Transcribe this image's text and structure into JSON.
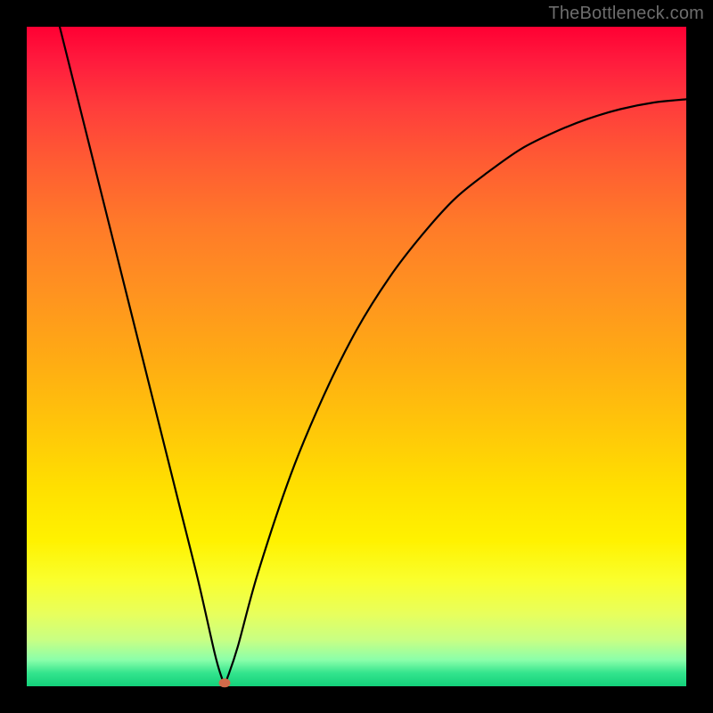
{
  "watermark": {
    "text": "TheBottleneck.com"
  },
  "chart_data": {
    "type": "line",
    "title": "",
    "xlabel": "",
    "ylabel": "",
    "xlim": [
      0,
      1
    ],
    "ylim": [
      0,
      1
    ],
    "series": [
      {
        "name": "curve",
        "points": [
          {
            "x": 0.05,
            "y": 1.0
          },
          {
            "x": 0.08,
            "y": 0.88
          },
          {
            "x": 0.11,
            "y": 0.76
          },
          {
            "x": 0.14,
            "y": 0.64
          },
          {
            "x": 0.17,
            "y": 0.52
          },
          {
            "x": 0.2,
            "y": 0.4
          },
          {
            "x": 0.23,
            "y": 0.28
          },
          {
            "x": 0.26,
            "y": 0.16
          },
          {
            "x": 0.285,
            "y": 0.05
          },
          {
            "x": 0.295,
            "y": 0.015
          },
          {
            "x": 0.3,
            "y": 0.005
          },
          {
            "x": 0.305,
            "y": 0.015
          },
          {
            "x": 0.32,
            "y": 0.06
          },
          {
            "x": 0.35,
            "y": 0.17
          },
          {
            "x": 0.4,
            "y": 0.32
          },
          {
            "x": 0.45,
            "y": 0.44
          },
          {
            "x": 0.5,
            "y": 0.54
          },
          {
            "x": 0.55,
            "y": 0.62
          },
          {
            "x": 0.6,
            "y": 0.685
          },
          {
            "x": 0.65,
            "y": 0.74
          },
          {
            "x": 0.7,
            "y": 0.78
          },
          {
            "x": 0.75,
            "y": 0.815
          },
          {
            "x": 0.8,
            "y": 0.84
          },
          {
            "x": 0.85,
            "y": 0.86
          },
          {
            "x": 0.9,
            "y": 0.875
          },
          {
            "x": 0.95,
            "y": 0.885
          },
          {
            "x": 1.0,
            "y": 0.89
          }
        ]
      }
    ],
    "marker": {
      "x": 0.3,
      "y": 0.005,
      "color": "#d16a4a"
    },
    "gradient_stops": [
      {
        "pos": 0.0,
        "color": "#ff0033"
      },
      {
        "pos": 0.5,
        "color": "#ffaa14"
      },
      {
        "pos": 0.78,
        "color": "#fff200"
      },
      {
        "pos": 1.0,
        "color": "#13d17a"
      }
    ]
  }
}
